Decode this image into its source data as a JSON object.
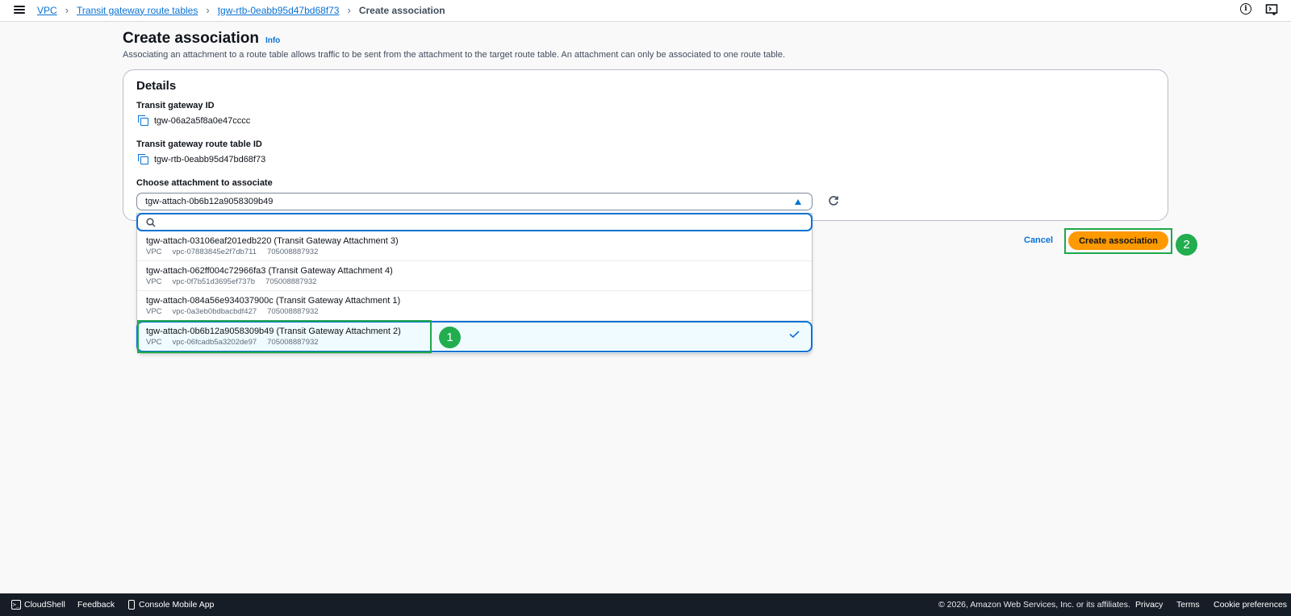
{
  "breadcrumb": {
    "items": [
      "VPC",
      "Transit gateway route tables",
      "tgw-rtb-0eabb95d47bd68f73"
    ],
    "current": "Create association"
  },
  "header": {
    "title": "Create association",
    "info_label": "Info",
    "description": "Associating an attachment to a route table allows traffic to be sent from the attachment to the target route table. An attachment can only be associated to one route table."
  },
  "details": {
    "title": "Details",
    "tgw_label": "Transit gateway ID",
    "tgw_value": "tgw-06a2a5f8a0e47cccc",
    "rtb_label": "Transit gateway route table ID",
    "rtb_value": "tgw-rtb-0eabb95d47bd68f73",
    "attach_label": "Choose attachment to associate",
    "attach_selected": "tgw-attach-0b6b12a9058309b49"
  },
  "dropdown": {
    "search_placeholder": "",
    "options": [
      {
        "label": "tgw-attach-03106eaf201edb220 (Transit Gateway Attachment 3)",
        "type": "VPC",
        "vpc": "vpc-07883845e2f7db711",
        "account": "705008887932"
      },
      {
        "label": "tgw-attach-062ff004c72966fa3 (Transit Gateway Attachment 4)",
        "type": "VPC",
        "vpc": "vpc-0f7b51d3695ef737b",
        "account": "705008887932"
      },
      {
        "label": "tgw-attach-084a56e934037900c (Transit Gateway Attachment 1)",
        "type": "VPC",
        "vpc": "vpc-0a3eb0bdbacbdf427",
        "account": "705008887932"
      },
      {
        "label": "tgw-attach-0b6b12a9058309b49 (Transit Gateway Attachment 2)",
        "type": "VPC",
        "vpc": "vpc-06fcadb5a3202de97",
        "account": "705008887932",
        "selected": true
      }
    ]
  },
  "actions": {
    "cancel": "Cancel",
    "create": "Create association"
  },
  "annotations": [
    "1",
    "2"
  ],
  "footer": {
    "cloudshell": "CloudShell",
    "feedback": "Feedback",
    "mobile_app": "Console Mobile App",
    "copyright": "© 2026, Amazon Web Services, Inc. or its affiliates.",
    "privacy": "Privacy",
    "terms": "Terms",
    "cookie": "Cookie preferences"
  },
  "colors": {
    "link": "#0972d3",
    "primary_button": "#ff9900",
    "annotation": "#22ad4f",
    "footer_bg": "#161d26"
  }
}
